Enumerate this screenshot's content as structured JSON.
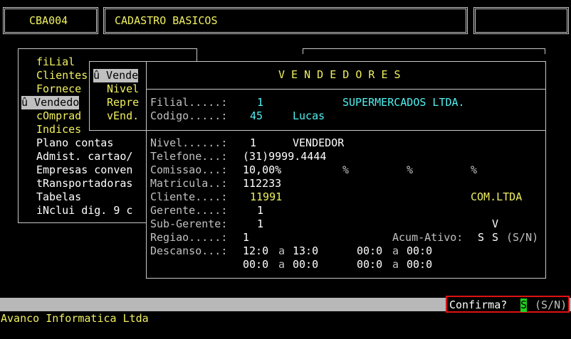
{
  "header": {
    "code": "CBA004",
    "title": "CADASTRO BASICOS"
  },
  "main_menu": {
    "items": [
      {
        "hot": "",
        "rest": "fiLial"
      },
      {
        "hot": "",
        "rest": "Clientes"
      },
      {
        "hot": "",
        "rest": "Fornece"
      },
      {
        "hot": "",
        "rest": "û Vendedo"
      },
      {
        "hot": "",
        "rest": "cOmprad"
      },
      {
        "hot": "",
        "rest": "Indices"
      },
      {
        "hot": "",
        "rest": "Plano contas"
      },
      {
        "hot": "",
        "rest": "Admist. cartao/"
      },
      {
        "hot": "",
        "rest": "Empresas conven"
      },
      {
        "hot": "",
        "rest": "tRansportadoras"
      },
      {
        "hot": "",
        "rest": "Tabelas"
      },
      {
        "hot": "",
        "rest": "iNclui dig. 9 c"
      }
    ]
  },
  "sub_menu": {
    "items": [
      "û Vende",
      "Nivel",
      "Repre",
      "vEnd."
    ]
  },
  "form": {
    "title": "V E N D E D O R E S",
    "filial_label": "Filial.....:",
    "filial_value": "1",
    "filial_name": "SUPERMERCADOS LTDA.",
    "codigo_label": "Codigo.....:",
    "codigo_value": "45",
    "codigo_name": "Lucas",
    "nivel_label": "Nivel......:",
    "nivel_value": "1",
    "nivel_name": "VENDEDOR",
    "telefone_label": "Telefone...:",
    "telefone_value": "(31)9999.4444",
    "comissao_label": "Comissao...:",
    "comissao_value": "10,00%",
    "pct1": "%",
    "pct2": "%",
    "pct3": "%",
    "matricula_label": "Matricula..:",
    "matricula_value": "112233",
    "cliente_label": "Cliente....:",
    "cliente_value": "11991",
    "cliente_name": "COM.LTDA",
    "gerente_label": "Gerente....:",
    "gerente_value": "1",
    "subgerente_label": "Sub-Gerente:",
    "subgerente_value": "1",
    "subgerente_flag": "V",
    "regiao_label": "Regiao.....:",
    "regiao_value": "1",
    "acum_label": "Acum-Ativo:",
    "acum_value1": "S",
    "acum_value2": "S",
    "acum_hint": "(S/N)",
    "descanso_label": "Descanso...:",
    "d1_from": "12:0",
    "d1_to": "13:0",
    "d2_from": "00:0",
    "d2_to": "00:0",
    "d3_from": "00:0",
    "d3_to": "00:0",
    "d4_from": "00:0",
    "d4_to": "00:0",
    "a": "a"
  },
  "prompt": {
    "label": "Confirma?",
    "value": "S",
    "hint": "(S/N)"
  },
  "footer": {
    "company": "Avanco Informatica Ltda"
  }
}
